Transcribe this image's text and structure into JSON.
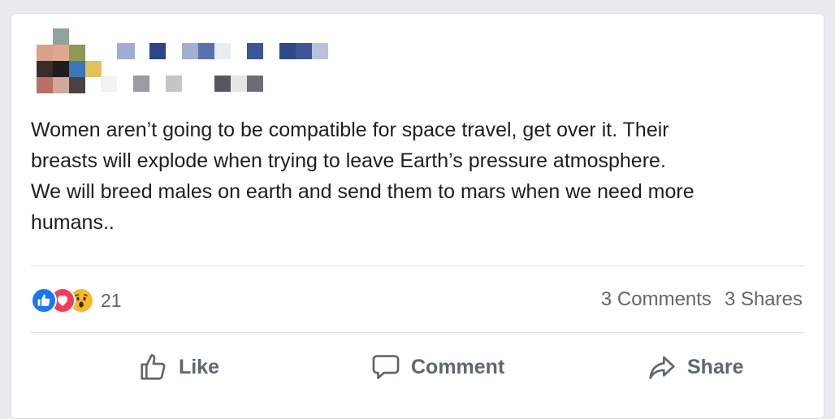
{
  "post": {
    "text_lines": [
      "Women aren’t going to be compatible for space travel, get over it. Their",
      "breasts will explode when trying to leave Earth’s pressure atmosphere.",
      "We will breed males on earth and send them to mars when we need more",
      "humans.."
    ]
  },
  "reactions": {
    "icons": [
      "like-icon",
      "love-icon",
      "wow-icon"
    ],
    "count": "21"
  },
  "stats": {
    "comments": "3 Comments",
    "shares": "3 Shares"
  },
  "actions": {
    "like_label": "Like",
    "comment_label": "Comment",
    "share_label": "Share"
  },
  "colors": {
    "like_blue": "#1877f2",
    "love_red": "#f33e58",
    "wow_yellow": "#f7b928",
    "text": "#1c1e21",
    "muted": "#606770"
  }
}
